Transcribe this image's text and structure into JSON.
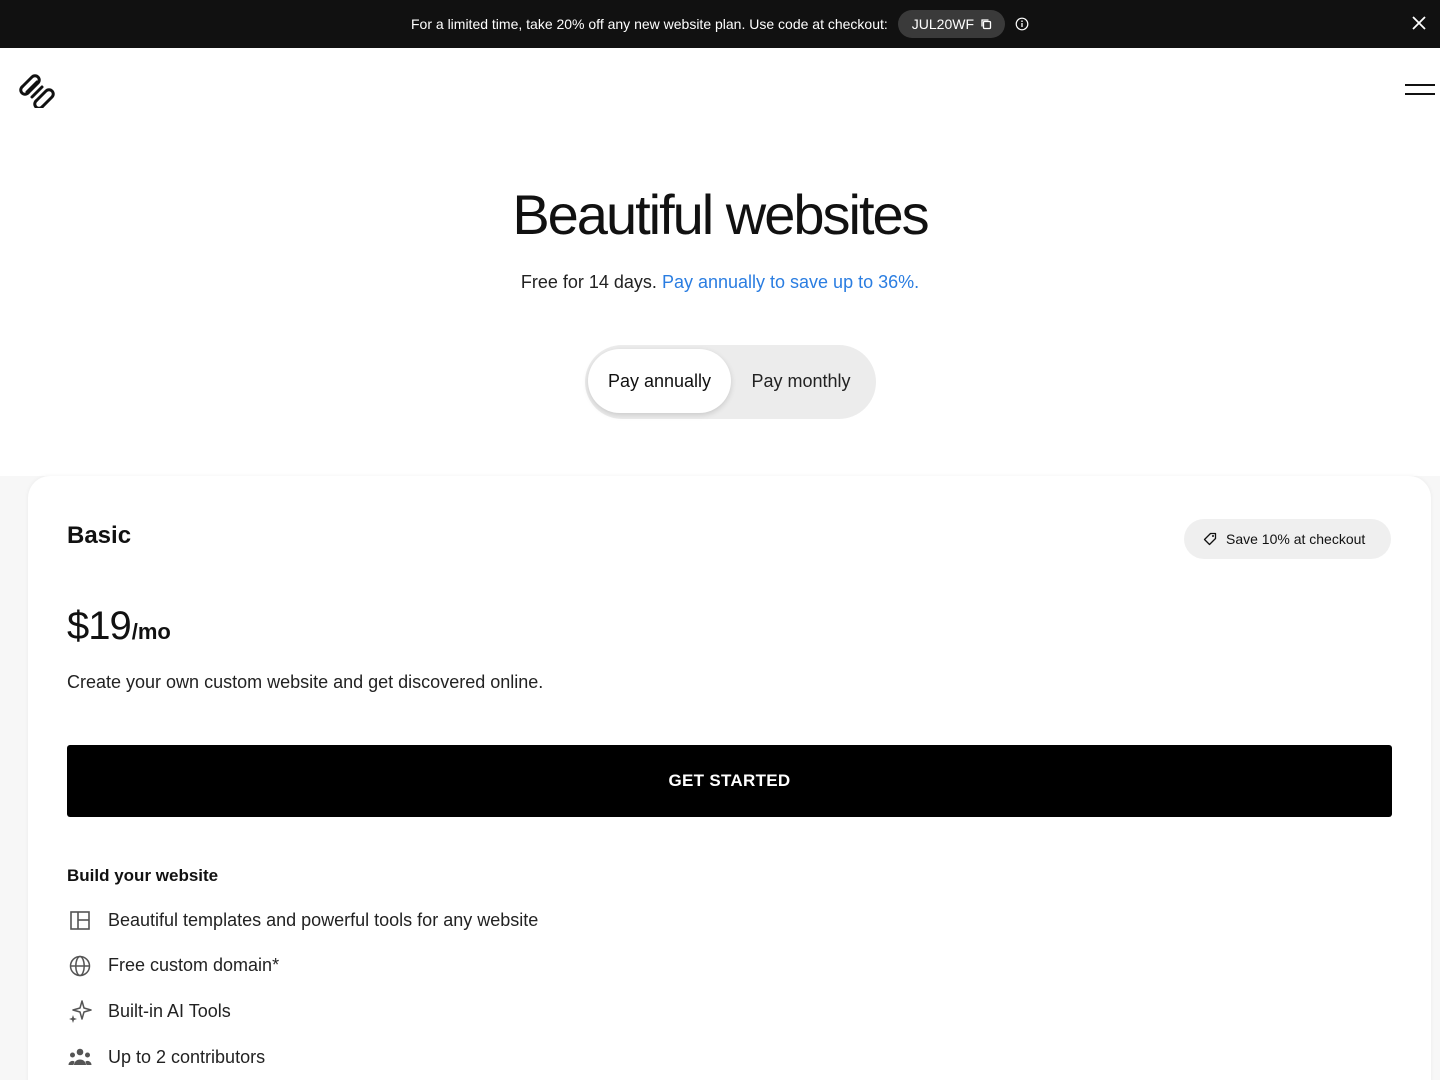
{
  "promo": {
    "text": "For a limited time, take 20% off any new website plan. Use code at checkout:",
    "code": "JUL20WF",
    "icons": [
      "copy-icon",
      "info-icon",
      "close-icon"
    ]
  },
  "header": {
    "logo": "squarespace-logo",
    "menu_icon": "hamburger-menu-icon"
  },
  "hero": {
    "title": "Beautiful websites",
    "subtitle_plain": "Free for 14 days.",
    "subtitle_link": "Pay annually to save up to 36%.",
    "link_color": "#2a7de1",
    "toggle": {
      "annual": "Pay annually",
      "monthly": "Pay monthly",
      "selected": "Pay annually"
    }
  },
  "plan": {
    "name": "Basic",
    "badge": "Save 10% at checkout",
    "price": "$19",
    "period": "/mo",
    "description": "Create your own custom website and get discovered online.",
    "cta": "GET STARTED",
    "features_heading": "Build your website",
    "features": [
      {
        "icon": "layout-template-icon",
        "label": "Beautiful templates and powerful tools for any website"
      },
      {
        "icon": "globe-icon",
        "label": "Free custom domain*"
      },
      {
        "icon": "sparkle-ai-icon",
        "label": "Built-in AI Tools"
      },
      {
        "icon": "contributors-icon",
        "label": "Up to 2 contributors"
      }
    ]
  }
}
